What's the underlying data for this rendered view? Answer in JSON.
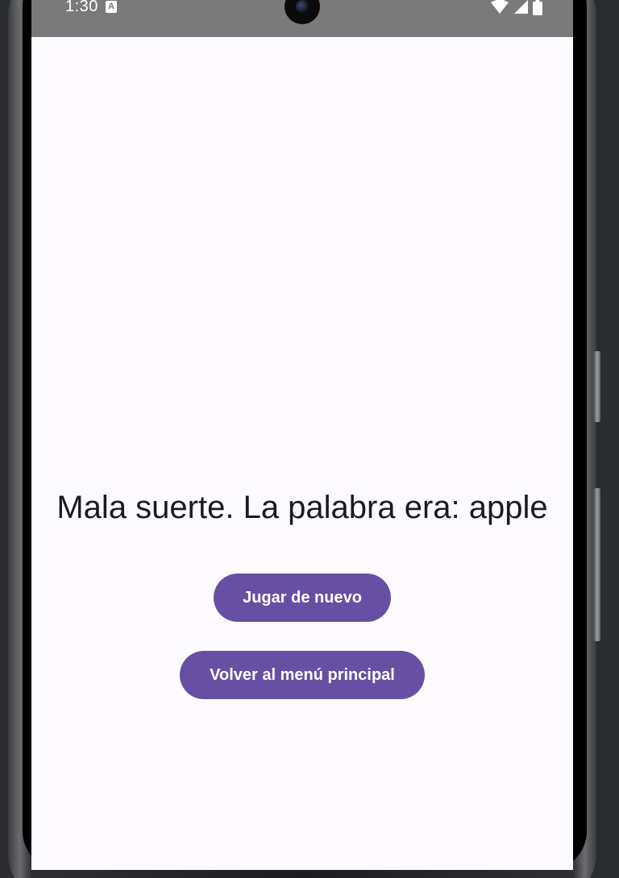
{
  "status_bar": {
    "time": "1:30",
    "notification_icon": "A",
    "icons": [
      "wifi-icon",
      "signal-icon",
      "battery-icon"
    ]
  },
  "game_over": {
    "message": "Mala suerte. La palabra era: apple",
    "play_again_label": "Jugar de nuevo",
    "main_menu_label": "Volver al menú principal"
  },
  "colors": {
    "primary": "#6750a4",
    "background": "#fdfbff",
    "status_bar": "#7a7a7a",
    "text": "#1b1b1f"
  }
}
